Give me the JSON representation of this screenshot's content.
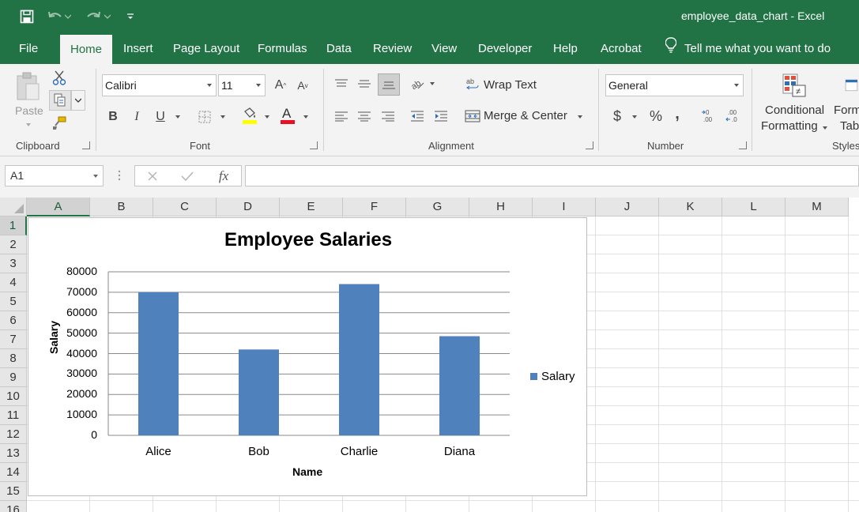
{
  "window": {
    "title": "employee_data_chart  -  Excel"
  },
  "menu_tabs": [
    "File",
    "Home",
    "Insert",
    "Page Layout",
    "Formulas",
    "Data",
    "Review",
    "View",
    "Developer",
    "Help",
    "Acrobat"
  ],
  "active_tab": "Home",
  "tell_me": "Tell me what you want to do",
  "ribbon": {
    "clipboard": {
      "paste_label": "Paste",
      "group_label": "Clipboard"
    },
    "font": {
      "font_name": "Calibri",
      "font_size": "11",
      "bold": "B",
      "italic": "I",
      "underline": "U",
      "grow": "A",
      "shrink": "A",
      "font_color_glyph": "A",
      "group_label": "Font"
    },
    "alignment": {
      "wrap_text": "Wrap Text",
      "merge_center": "Merge & Center",
      "group_label": "Alignment"
    },
    "number": {
      "format": "General",
      "currency": "$",
      "percent": "%",
      "comma": ",",
      "group_label": "Number"
    },
    "styles": {
      "cond_line1": "Conditional",
      "cond_line2": "Formatting",
      "table_line1": "Form",
      "table_line2": "Tabl",
      "group_label": "Styles"
    }
  },
  "formula_bar": {
    "name_box": "A1",
    "fx": "fx",
    "value": ""
  },
  "columns": [
    "A",
    "B",
    "C",
    "D",
    "E",
    "F",
    "G",
    "H",
    "I",
    "J",
    "K",
    "L",
    "M"
  ],
  "rows": [
    "1",
    "2",
    "3",
    "4",
    "5",
    "6",
    "7",
    "8",
    "9",
    "10",
    "11",
    "12",
    "13",
    "14",
    "15",
    "16"
  ],
  "selected_cell": {
    "column": "A",
    "row": "1"
  },
  "colors": {
    "excel_green": "#217346",
    "bar_blue": "#4f81bd"
  },
  "chart_data": {
    "type": "bar",
    "title": "Employee Salaries",
    "xlabel": "Name",
    "ylabel": "Salary",
    "categories": [
      "Alice",
      "Bob",
      "Charlie",
      "Diana"
    ],
    "series": [
      {
        "name": "Salary",
        "values": [
          70000,
          42000,
          74000,
          48500
        ]
      }
    ],
    "ylim": [
      0,
      80000
    ],
    "yticks": [
      "0",
      "10000",
      "20000",
      "30000",
      "40000",
      "50000",
      "60000",
      "70000",
      "80000"
    ],
    "grid": true,
    "legend": "right"
  }
}
